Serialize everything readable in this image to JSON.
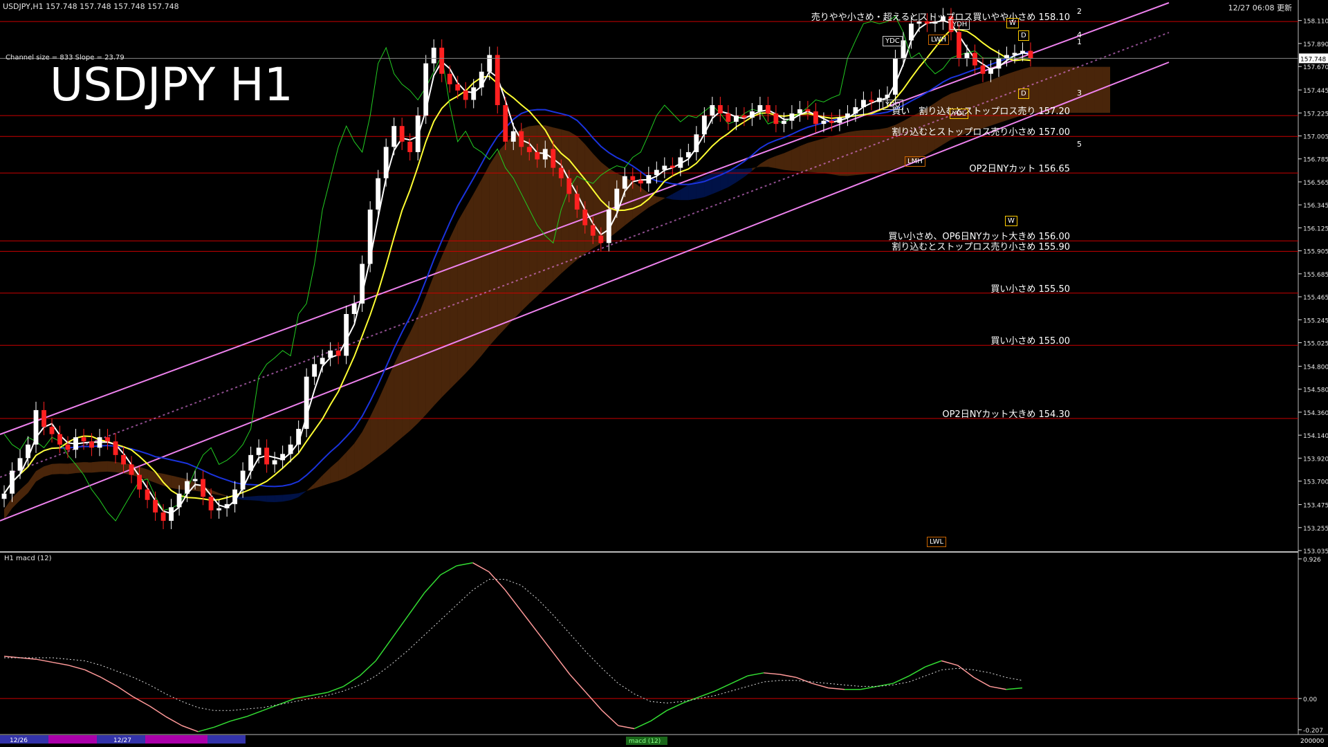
{
  "header": {
    "symbol_info": "USDJPY,H1  157.748 157.748 157.748 157.748",
    "updated": "12/27 06:08 更新",
    "big_title": "USDJPY H1",
    "channel_info": "Channel size = 833  Slope = 23.79",
    "macd_label": "H1  macd (12)"
  },
  "colors": {
    "background": "#000000",
    "price_axis": "#e6e6e6",
    "channel_line": "#ee82ee",
    "level_line": "#cc0000",
    "cloud_bull": "#0033cc",
    "cloud_bear": "#d2691e",
    "ma_fast": "#ffffff",
    "ma_mid": "#ffff33",
    "ma_slow": "#1a33dd",
    "chikou": "#22cc22",
    "macd_up": "#33dd33",
    "macd_down": "#ff9999",
    "signal": "#dddddd"
  },
  "chart_data": [
    {
      "type": "candlestick",
      "title": "USDJPY H1",
      "y_ticks": [
        "158.110",
        "157.890",
        "157.670",
        "157.445",
        "157.225",
        "157.005",
        "156.785",
        "156.565",
        "156.345",
        "156.125",
        "155.905",
        "155.685",
        "155.465",
        "155.245",
        "155.025",
        "154.800",
        "154.580",
        "154.360",
        "154.140",
        "153.920",
        "153.700",
        "153.475",
        "153.255",
        "153.035"
      ],
      "ylim": [
        153.035,
        158.28
      ],
      "current_price": "157.748",
      "levels": [
        {
          "value": 158.1,
          "label": "売りやや小さめ・超えるとストップロス買いやや小さめ 158.10"
        },
        {
          "value": 157.2,
          "label": "買い　割り込むとストップロス売り 157.20"
        },
        {
          "value": 157.0,
          "label": "割り込むとストップロス売り小さめ 157.00"
        },
        {
          "value": 156.65,
          "label": "OP2日NYカット 156.65"
        },
        {
          "value": 156.0,
          "label": "買い小さめ、OP6日NYカット大きめ 156.00"
        },
        {
          "value": 155.9,
          "label": "割り込むとストップロス売り小さめ 155.90"
        },
        {
          "value": 155.5,
          "label": "買い小さめ 155.50"
        },
        {
          "value": 155.0,
          "label": "買い小さめ 155.00"
        },
        {
          "value": 154.3,
          "label": "OP2日NYカット大きめ 154.30"
        }
      ],
      "tags": [
        "YDC",
        "YDH",
        "LWH",
        "YDO",
        "YDL",
        "LMH",
        "LWL",
        "W",
        "D",
        "W",
        "D"
      ],
      "fib_marks": [
        "2",
        "4",
        "1",
        "3",
        "5"
      ],
      "closes": [
        153.58,
        153.8,
        153.92,
        154.05,
        154.38,
        154.22,
        154.15,
        154.05,
        154.0,
        154.12,
        154.08,
        154.02,
        154.12,
        154.08,
        153.95,
        153.86,
        153.76,
        153.62,
        153.52,
        153.4,
        153.32,
        153.45,
        153.58,
        153.7,
        153.72,
        153.55,
        153.42,
        153.44,
        153.48,
        153.62,
        153.8,
        153.95,
        154.02,
        153.86,
        153.9,
        153.96,
        154.05,
        154.2,
        154.7,
        154.82,
        154.88,
        154.95,
        154.9,
        155.3,
        155.4,
        155.78,
        156.3,
        156.6,
        156.9,
        157.1,
        156.95,
        156.85,
        157.2,
        157.7,
        157.85,
        157.6,
        157.5,
        157.44,
        157.35,
        157.47,
        157.62,
        157.78,
        157.3,
        156.95,
        157.05,
        156.9,
        156.85,
        156.78,
        156.88,
        156.7,
        156.6,
        156.45,
        156.3,
        156.15,
        156.05,
        155.98,
        156.3,
        156.5,
        156.62,
        156.58,
        156.55,
        156.63,
        156.68,
        156.72,
        156.7,
        156.8,
        156.85,
        157.02,
        157.2,
        157.3,
        157.22,
        157.14,
        157.2,
        157.18,
        157.24,
        157.3,
        157.22,
        157.12,
        157.15,
        157.22,
        157.26,
        157.24,
        157.12,
        157.15,
        157.13,
        157.18,
        157.22,
        157.28,
        157.35,
        157.33,
        157.37,
        157.4,
        157.75,
        157.92,
        158.08,
        158.1,
        158.08,
        158.1,
        158.15,
        158.0,
        157.75,
        157.8,
        157.68,
        157.6,
        157.65,
        157.75,
        157.78,
        157.8,
        157.82,
        157.75
      ]
    },
    {
      "type": "line",
      "title": "H1 macd (12)",
      "y_ticks": [
        "0.926",
        "0.00",
        "-0.207"
      ],
      "ylim": [
        -0.207,
        0.926
      ],
      "series": [
        {
          "name": "macd",
          "values": [
            0.28,
            0.27,
            0.26,
            0.24,
            0.22,
            0.19,
            0.14,
            0.08,
            0.01,
            -0.05,
            -0.12,
            -0.18,
            -0.22,
            -0.19,
            -0.15,
            -0.12,
            -0.08,
            -0.04,
            0.0,
            0.02,
            0.04,
            0.08,
            0.15,
            0.25,
            0.4,
            0.55,
            0.7,
            0.82,
            0.88,
            0.9,
            0.84,
            0.72,
            0.58,
            0.44,
            0.3,
            0.16,
            0.04,
            -0.08,
            -0.18,
            -0.2,
            -0.15,
            -0.08,
            -0.03,
            0.01,
            0.05,
            0.1,
            0.15,
            0.17,
            0.16,
            0.14,
            0.1,
            0.07,
            0.06,
            0.06,
            0.08,
            0.1,
            0.15,
            0.21,
            0.25,
            0.22,
            0.14,
            0.08,
            0.06,
            0.07
          ]
        },
        {
          "name": "signal",
          "values": [
            0.27,
            0.27,
            0.27,
            0.27,
            0.26,
            0.25,
            0.22,
            0.18,
            0.14,
            0.09,
            0.03,
            -0.02,
            -0.06,
            -0.08,
            -0.08,
            -0.07,
            -0.06,
            -0.04,
            -0.02,
            0.0,
            0.02,
            0.05,
            0.09,
            0.15,
            0.23,
            0.32,
            0.42,
            0.52,
            0.62,
            0.72,
            0.79,
            0.79,
            0.75,
            0.66,
            0.55,
            0.43,
            0.31,
            0.2,
            0.1,
            0.03,
            -0.02,
            -0.03,
            -0.02,
            0.0,
            0.02,
            0.05,
            0.08,
            0.11,
            0.12,
            0.12,
            0.11,
            0.1,
            0.09,
            0.08,
            0.08,
            0.09,
            0.11,
            0.15,
            0.19,
            0.2,
            0.19,
            0.17,
            0.14,
            0.12
          ]
        }
      ]
    }
  ],
  "time_axis": [
    "12/26",
    "12/27"
  ],
  "footer_label": "macd (12)",
  "footer_value": "200000"
}
